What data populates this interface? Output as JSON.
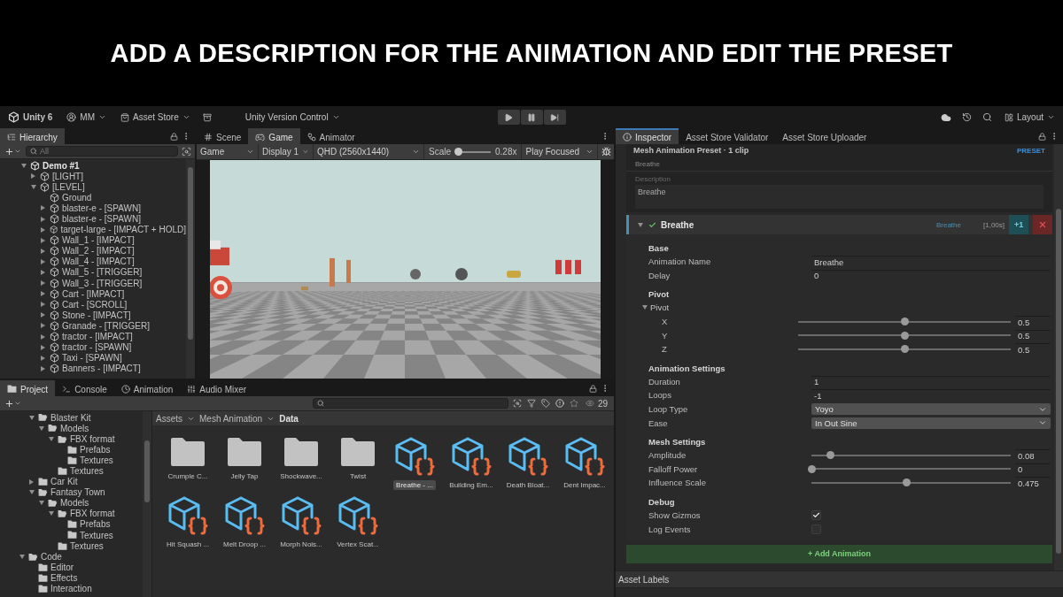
{
  "banner": {
    "title": "ADD A DESCRIPTION FOR THE ANIMATION AND EDIT THE PRESET"
  },
  "toolbar": {
    "product": "Unity 6",
    "account": "MM",
    "store": "Asset Store",
    "version_control": "Unity Version Control",
    "layout": "Layout"
  },
  "hierarchy": {
    "tab": "Hierarchy",
    "search_placeholder": "All",
    "tree": [
      {
        "label": "Demo #1",
        "kind": "scene",
        "expanded": true,
        "children": [
          {
            "label": "[LIGHT]",
            "kind": "object",
            "expanded": false
          },
          {
            "label": "[LEVEL]",
            "kind": "object",
            "expanded": true,
            "children": [
              {
                "label": "Ground",
                "kind": "object"
              },
              {
                "label": "blaster-e - [SPAWN]",
                "kind": "object",
                "expanded": false
              },
              {
                "label": "blaster-e - [SPAWN]",
                "kind": "object",
                "expanded": false
              },
              {
                "label": "target-large - [IMPACT + HOLD]",
                "kind": "object",
                "expanded": false
              },
              {
                "label": "Wall_1 - [IMPACT]",
                "kind": "object",
                "expanded": false
              },
              {
                "label": "Wall_2 - [IMPACT]",
                "kind": "object",
                "expanded": false
              },
              {
                "label": "Wall_4 - [IMPACT]",
                "kind": "object",
                "expanded": false
              },
              {
                "label": "Wall_5 - [TRIGGER]",
                "kind": "object",
                "expanded": false
              },
              {
                "label": "Wall_3 - [TRIGGER]",
                "kind": "object",
                "expanded": false
              },
              {
                "label": "Cart - [IMPACT]",
                "kind": "object",
                "expanded": false
              },
              {
                "label": "Cart - [SCROLL]",
                "kind": "object",
                "expanded": false
              },
              {
                "label": "Stone - [IMPACT]",
                "kind": "object",
                "expanded": false
              },
              {
                "label": "Granade - [TRIGGER]",
                "kind": "object",
                "expanded": false
              },
              {
                "label": "tractor - [IMPACT]",
                "kind": "object",
                "expanded": false
              },
              {
                "label": "tractor - [SPAWN]",
                "kind": "object",
                "expanded": false
              },
              {
                "label": "Taxi - [SPAWN]",
                "kind": "object",
                "expanded": false
              },
              {
                "label": "Banners - [IMPACT]",
                "kind": "object",
                "expanded": false
              }
            ]
          }
        ]
      }
    ]
  },
  "scene": {
    "tabs": [
      {
        "label": "Scene",
        "kind": "scene",
        "selected": false
      },
      {
        "label": "Game",
        "kind": "game",
        "selected": true
      },
      {
        "label": "Animator",
        "kind": "animator",
        "selected": false
      }
    ],
    "game_bar": {
      "display_mode": "Game",
      "display": "Display 1",
      "resolution": "QHD (2560x1440)",
      "scale": {
        "label": "Scale",
        "level": 0.08,
        "reading": "0.28x"
      },
      "play_mode": "Play Focused"
    }
  },
  "project": {
    "tabs": [
      {
        "label": "Project",
        "kind": "project",
        "selected": true
      },
      {
        "label": "Console",
        "kind": "console",
        "selected": false
      },
      {
        "label": "Animation",
        "kind": "animation",
        "selected": false
      },
      {
        "label": "Audio Mixer",
        "kind": "mixer",
        "selected": false
      }
    ],
    "count": "29",
    "tree": [
      {
        "children": [
          {
            "label": "Blaster Kit",
            "expanded": true,
            "children": [
              {
                "label": "Models",
                "expanded": true,
                "children": [
                  {
                    "label": "FBX format",
                    "expanded": true,
                    "children": [
                      {
                        "label": "Prefabs"
                      },
                      {
                        "label": "Textures"
                      }
                    ]
                  },
                  {
                    "label": "Textures"
                  }
                ]
              }
            ]
          },
          {
            "label": "Car Kit",
            "expanded": false
          },
          {
            "label": "Fantasy Town",
            "expanded": true,
            "children": [
              {
                "label": "Models",
                "expanded": true,
                "children": [
                  {
                    "label": "FBX format",
                    "expanded": true,
                    "children": [
                      {
                        "label": "Prefabs"
                      },
                      {
                        "label": "Textures"
                      }
                    ]
                  },
                  {
                    "label": "Textures"
                  }
                ]
              }
            ]
          }
        ]
      },
      {
        "label": "Code",
        "expanded": true,
        "children": [
          {
            "label": "Editor"
          },
          {
            "label": "Effects"
          },
          {
            "label": "Interaction"
          }
        ]
      }
    ],
    "breadcrumb": [
      "Assets",
      "Mesh Animation",
      "Data"
    ],
    "assets": [
      {
        "label": "Crumple C...",
        "kind": "folder",
        "selected": false
      },
      {
        "label": "Jelly Tap",
        "kind": "folder",
        "selected": false
      },
      {
        "label": "Shockwave...",
        "kind": "folder",
        "selected": false
      },
      {
        "label": "Twist",
        "kind": "folder",
        "selected": false
      },
      {
        "label": "Breathe - ...",
        "kind": "preset",
        "selected": true
      },
      {
        "label": "Building Em...",
        "kind": "preset",
        "selected": false
      },
      {
        "label": "Death Bloat...",
        "kind": "preset",
        "selected": false
      },
      {
        "label": "Dent Impac...",
        "kind": "preset",
        "selected": false
      },
      {
        "label": "Hit Squash ...",
        "kind": "preset",
        "selected": false
      },
      {
        "label": "Melt Droop ...",
        "kind": "preset",
        "selected": false
      },
      {
        "label": "Morph Nois...",
        "kind": "preset",
        "selected": false
      },
      {
        "label": "Vertex Scat...",
        "kind": "preset",
        "selected": false
      }
    ]
  },
  "inspector": {
    "tabs": [
      {
        "label": "Inspector",
        "selected": true
      },
      {
        "label": "Asset Store Validator",
        "selected": false
      },
      {
        "label": "Asset Store Uploader",
        "selected": false
      }
    ],
    "header": {
      "title": "Mesh Animation Preset · 1 clip",
      "badge": "PRESET",
      "name": "Breathe"
    },
    "description": {
      "label": "Description",
      "value": "Breathe"
    },
    "clip": {
      "name": "Breathe",
      "expanded": true,
      "enabled": true,
      "tag": "Breathe",
      "duration": "[1,00s]",
      "add_label": "+1"
    },
    "sections": [
      {
        "title": "Base",
        "fields": [
          {
            "kind": "text",
            "label": "Animation Name",
            "value": "Breathe"
          },
          {
            "kind": "text",
            "label": "Delay",
            "value": "0"
          }
        ]
      },
      {
        "title": "Pivot",
        "fields": [
          {
            "kind": "foldout",
            "label": "Pivot",
            "expanded": true,
            "children": [
              {
                "kind": "slider",
                "label": "X",
                "level": 0.5,
                "value": "0.5"
              },
              {
                "kind": "slider",
                "label": "Y",
                "level": 0.5,
                "value": "0.5"
              },
              {
                "kind": "slider",
                "label": "Z",
                "level": 0.5,
                "value": "0.5"
              }
            ]
          }
        ]
      },
      {
        "title": "Animation Settings",
        "fields": [
          {
            "kind": "text",
            "label": "Duration",
            "value": "1"
          },
          {
            "kind": "text",
            "label": "Loops",
            "value": "-1"
          },
          {
            "kind": "dropdown",
            "label": "Loop Type",
            "value": "Yoyo"
          },
          {
            "kind": "dropdown",
            "label": "Ease",
            "value": "In Out Sine"
          }
        ]
      },
      {
        "title": "Mesh Settings",
        "fields": [
          {
            "kind": "slider",
            "label": "Amplitude",
            "level": 0.095,
            "value": "0.08"
          },
          {
            "kind": "slider",
            "label": "Falloff Power",
            "level": 0,
            "value": "0"
          },
          {
            "kind": "slider",
            "label": "Influence Scale",
            "level": 0.477,
            "value": "0.475"
          }
        ]
      },
      {
        "title": "Debug",
        "fields": [
          {
            "kind": "checkbox",
            "label": "Show Gizmos",
            "checked": true
          },
          {
            "kind": "checkbox",
            "label": "Log Events",
            "checked": false
          }
        ]
      }
    ],
    "add_button": "+ Add Animation",
    "asset_labels": "Asset Labels"
  }
}
